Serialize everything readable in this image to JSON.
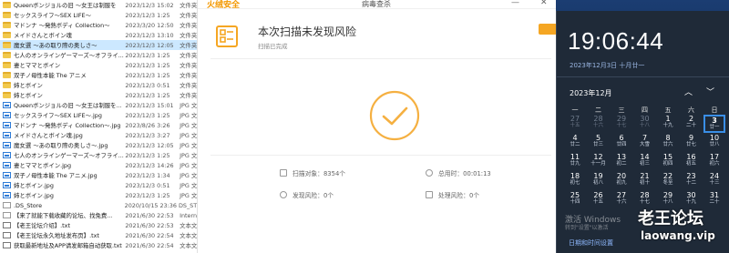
{
  "explorer": {
    "rows": [
      {
        "name": "Queenボンジョルの旧 ～女王は制服を",
        "date": "2023/12/3 15:02",
        "type": "文件夹",
        "icon": "folder"
      },
      {
        "name": "セックスライフ～SEX LIFE～",
        "date": "2023/12/3 1:25",
        "type": "文件夹",
        "icon": "folder"
      },
      {
        "name": "マドンナ ～発熱ボディ Collection～",
        "date": "2023/3/20 12:50",
        "type": "文件夹",
        "icon": "folder"
      },
      {
        "name": "メイドさんとボイン魂",
        "date": "2023/12/3 13:10",
        "type": "文件夹",
        "icon": "folder"
      },
      {
        "name": "魔女選 ～あの取り際の奥しさ～",
        "date": "2023/12/3 12:05",
        "type": "文件夹",
        "icon": "folder"
      },
      {
        "name": "七人のオンラインゲーマーズ～オフライ...",
        "date": "2023/12/3 1:25",
        "type": "文件夹",
        "icon": "folder"
      },
      {
        "name": "妻とママとボイン",
        "date": "2023/12/3 1:25",
        "type": "文件夹",
        "icon": "folder"
      },
      {
        "name": "双子ノ母性本能 The アニメ",
        "date": "2023/12/3 1:25",
        "type": "文件夹",
        "icon": "folder"
      },
      {
        "name": "姉とボイン",
        "date": "2023/12/3 0:51",
        "type": "文件夹",
        "icon": "folder"
      },
      {
        "name": "姉とボイン",
        "date": "2023/12/3 1:25",
        "type": "文件夹",
        "icon": "folder"
      },
      {
        "name": "Queenボンジョルの旧 ～女王は制服を...",
        "date": "2023/12/3 15:01",
        "type": "JPG 文件",
        "icon": "image"
      },
      {
        "name": "セックスライフ～SEX LIFE～.jpg",
        "date": "2023/12/3 1:25",
        "type": "JPG 文件",
        "icon": "image"
      },
      {
        "name": "マドンナ ～発熱ボディ Collection～.jpg",
        "date": "2023/8/26 3:26",
        "type": "JPG 文件",
        "icon": "image"
      },
      {
        "name": "メイドさんとボイン魂.jpg",
        "date": "2023/12/3 3:27",
        "type": "JPG 文件",
        "icon": "image"
      },
      {
        "name": "魔女選 ～あの取り際の奥しさ～.jpg",
        "date": "2023/12/3 12:05",
        "type": "JPG 文件",
        "icon": "image"
      },
      {
        "name": "七人のオンラインゲーマーズ～オフライ...",
        "date": "2023/12/3 1:25",
        "type": "JPG 文件",
        "icon": "image"
      },
      {
        "name": "妻とママとボイン.jpg",
        "date": "2023/12/3 14:26",
        "type": "JPG 文件",
        "icon": "image"
      },
      {
        "name": "双子ノ母性本能 The アニメ.jpg",
        "date": "2023/12/3 1:34",
        "type": "JPG 文件",
        "icon": "image"
      },
      {
        "name": "姉とボイン.jpg",
        "date": "2023/12/3 0:51",
        "type": "JPG 文件",
        "icon": "image"
      },
      {
        "name": "姉とボイン.jpg",
        "date": "2023/12/3 1:25",
        "type": "JPG 文件",
        "icon": "image"
      },
      {
        "name": ".DS_Store",
        "date": "2020/10/15 23:36",
        "type": "DS_STORE",
        "icon": "file"
      },
      {
        "name": "【来了就能下载收藏的论坛、找免费...",
        "date": "2021/6/30 22:53",
        "type": "Internet",
        "icon": "file"
      },
      {
        "name": "【老王论坛介绍】.txt",
        "date": "2021/6/30 22:53",
        "type": "文本文档",
        "icon": "txt"
      },
      {
        "name": "【老王论坛永久地址发布页】.txt",
        "date": "2021/6/30 22:54",
        "type": "文本文档",
        "icon": "txt"
      },
      {
        "name": "获取最新地址及APP请发邮箱自动获取.txt",
        "date": "2021/6/30 22:54",
        "type": "文本文档",
        "icon": "txt"
      }
    ]
  },
  "antivirus": {
    "logo": "火绒安全",
    "app_name": "病毒查杀",
    "min_btn": "—",
    "close_btn": "✕",
    "result_title": "本次扫描未发现风险",
    "result_subtitle": "扫描已完成",
    "stats": {
      "scanned_label": "扫描对象：8354个",
      "time_label": "总用时：00:01:13",
      "risk_label": "发现风险：0个",
      "handled_label": "处理风险：0个"
    },
    "accent_color": "#f5a623"
  },
  "clock": {
    "time": "19:06:44",
    "date": "2023年12月3日 十月廿一",
    "month": "2023年12月",
    "weekdays": [
      "一",
      "二",
      "三",
      "四",
      "五",
      "六",
      "日"
    ],
    "days": [
      [
        {
          "n": "27",
          "l": "十五",
          "dim": true
        },
        {
          "n": "28",
          "l": "十六",
          "dim": true
        },
        {
          "n": "29",
          "l": "十七",
          "dim": true
        },
        {
          "n": "30",
          "l": "十八",
          "dim": true
        },
        {
          "n": "1",
          "l": "十九",
          "dim": false
        },
        {
          "n": "2",
          "l": "二十",
          "dim": false
        },
        {
          "n": "3",
          "l": "廿一",
          "dim": false,
          "today": true
        }
      ],
      [
        {
          "n": "4",
          "l": "廿二"
        },
        {
          "n": "5",
          "l": "廿三"
        },
        {
          "n": "6",
          "l": "廿四"
        },
        {
          "n": "7",
          "l": "大雪"
        },
        {
          "n": "8",
          "l": "廿六"
        },
        {
          "n": "9",
          "l": "廿七"
        },
        {
          "n": "10",
          "l": "廿八"
        }
      ],
      [
        {
          "n": "11",
          "l": "廿九"
        },
        {
          "n": "12",
          "l": "十一月"
        },
        {
          "n": "13",
          "l": "初二"
        },
        {
          "n": "14",
          "l": "初三"
        },
        {
          "n": "15",
          "l": "初四"
        },
        {
          "n": "16",
          "l": "初五"
        },
        {
          "n": "17",
          "l": "初六"
        }
      ],
      [
        {
          "n": "18",
          "l": "初七"
        },
        {
          "n": "19",
          "l": "初八"
        },
        {
          "n": "20",
          "l": "初九"
        },
        {
          "n": "21",
          "l": "初十"
        },
        {
          "n": "22",
          "l": "冬至"
        },
        {
          "n": "23",
          "l": "十二"
        },
        {
          "n": "24",
          "l": "十三"
        }
      ],
      [
        {
          "n": "25",
          "l": "十四"
        },
        {
          "n": "26",
          "l": "十五"
        },
        {
          "n": "27",
          "l": "十六"
        },
        {
          "n": "28",
          "l": "十七"
        },
        {
          "n": "29",
          "l": "十八"
        },
        {
          "n": "30",
          "l": "十九"
        },
        {
          "n": "31",
          "l": "二十"
        }
      ]
    ],
    "settings_link": "日期和时间设置",
    "activate_line1": "激活 Windows",
    "activate_line2": "转到\"设置\"以激活",
    "accent_color": "#3a8ee6"
  },
  "watermark": {
    "cn": "老王论坛",
    "url": "laowang.vip"
  }
}
